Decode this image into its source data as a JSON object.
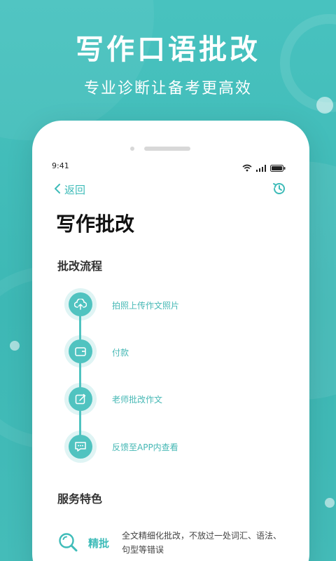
{
  "banner": {
    "headline": "写作口语批改",
    "subline": "专业诊断让备考更高效"
  },
  "status_bar": {
    "time": "9:41",
    "icons": [
      "wifi-icon",
      "signal-icon",
      "battery-icon"
    ]
  },
  "nav": {
    "back_label": "返回",
    "history_icon": "history-icon"
  },
  "page": {
    "title": "写作批改"
  },
  "process": {
    "section_title": "批改流程",
    "steps": [
      {
        "label": "拍照上传作文照片",
        "icon": "cloud-upload-icon"
      },
      {
        "label": "付款",
        "icon": "wallet-icon"
      },
      {
        "label": "老师批改作文",
        "icon": "edit-icon"
      },
      {
        "label": "反馈至APP内查看",
        "icon": "chat-icon"
      }
    ]
  },
  "features": {
    "section_title": "服务特色",
    "items": [
      {
        "name": "精批",
        "desc": "全文精细化批改，不放过一处词汇、语法、句型等错误",
        "icon": "magnifier-icon"
      }
    ]
  },
  "colors": {
    "accent": "#3fbcb9",
    "background": "#44bcb9"
  }
}
